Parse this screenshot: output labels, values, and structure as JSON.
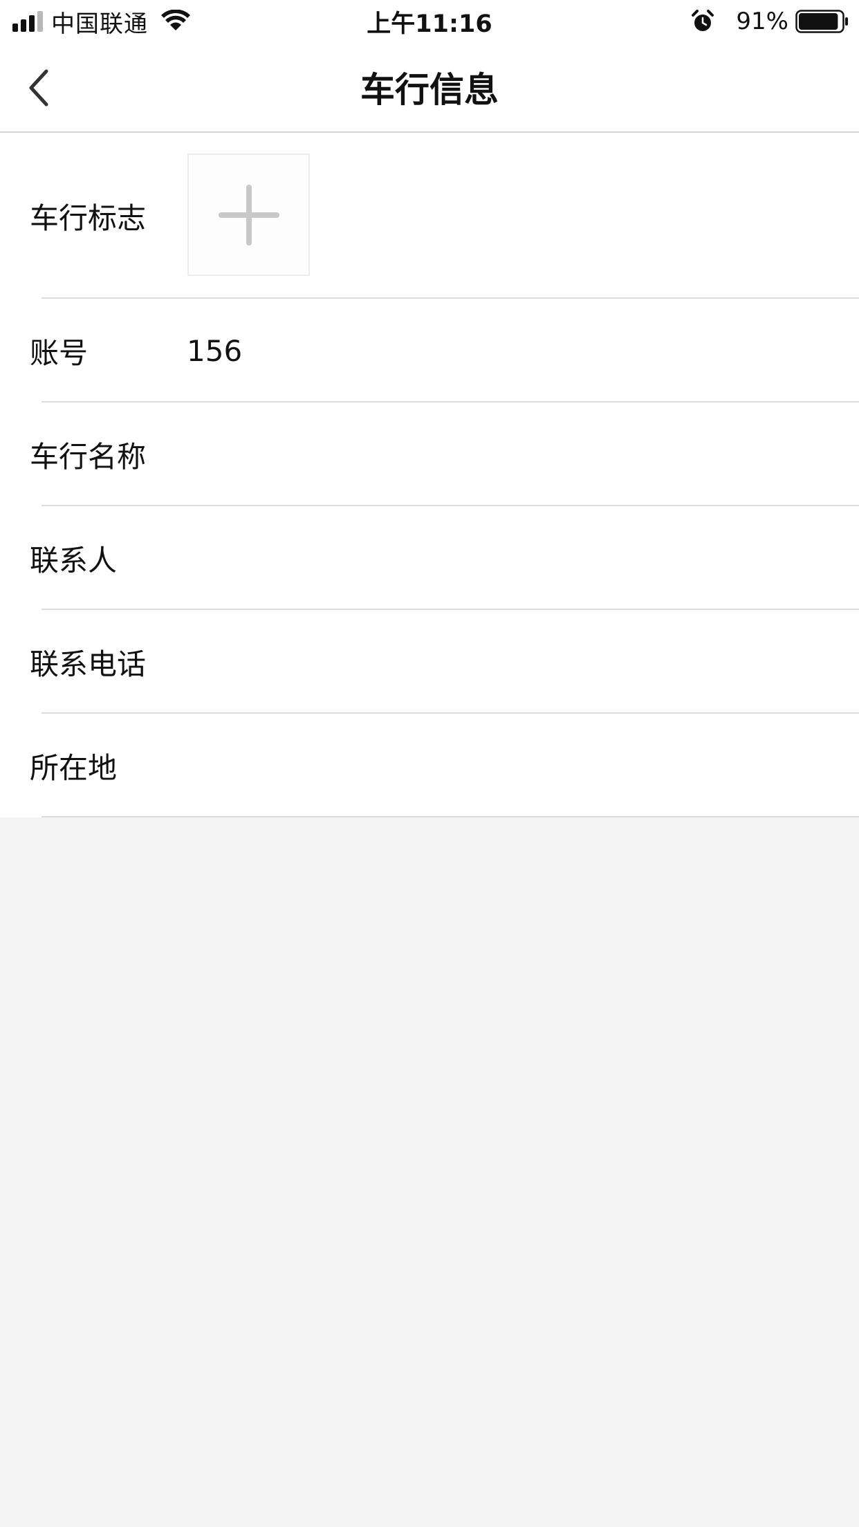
{
  "status_bar": {
    "carrier": "中国联通",
    "time": "上午11:16",
    "battery_percent": "91%",
    "battery_level": 0.91,
    "signal_bars_filled": 3,
    "signal_bars_total": 4,
    "icons": [
      "wifi-icon",
      "alarm-icon",
      "battery-icon"
    ]
  },
  "nav": {
    "title": "车行信息",
    "back_icon": "chevron-left-icon"
  },
  "form": {
    "logo": {
      "label": "车行标志",
      "icon": "plus-icon"
    },
    "account": {
      "label": "账号",
      "value": "156"
    },
    "name": {
      "label": "车行名称",
      "value": ""
    },
    "contact": {
      "label": "联系人",
      "value": ""
    },
    "phone": {
      "label": "联系电话",
      "value": ""
    },
    "location": {
      "label": "所在地",
      "value": ""
    }
  },
  "colors": {
    "background": "#f3f3f3",
    "surface": "#ffffff",
    "divider": "#dcdcdc",
    "plus_icon": "#c8c8c8",
    "text": "#111111"
  }
}
